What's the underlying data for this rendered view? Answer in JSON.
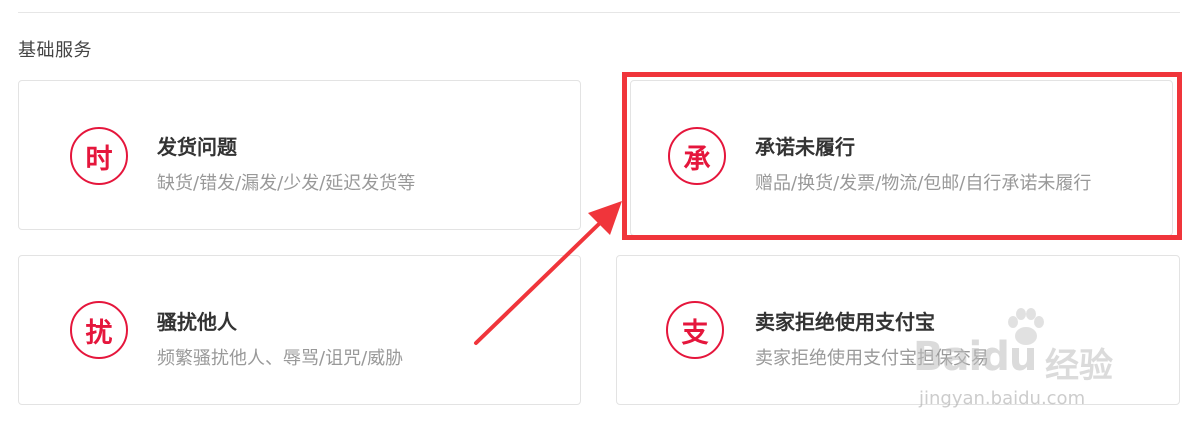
{
  "section_title": "基础服务",
  "cards": [
    {
      "badge": "时",
      "title": "发货问题",
      "desc": "缺货/错发/漏发/少发/延迟发货等"
    },
    {
      "badge": "承",
      "title": "承诺未履行",
      "desc": "赠品/换货/发票/物流/包邮/自行承诺未履行"
    },
    {
      "badge": "扰",
      "title": "骚扰他人",
      "desc": "频繁骚扰他人、辱骂/诅咒/威胁"
    },
    {
      "badge": "支",
      "title": "卖家拒绝使用支付宝",
      "desc": "卖家拒绝使用支付宝担保交易"
    }
  ],
  "watermark": {
    "logo": "Baidu",
    "cn": "经验",
    "url": "jingyan.baidu.com"
  },
  "colors": {
    "accent": "#e5163c",
    "highlight": "#f0353b"
  },
  "icons": [
    "arrow-icon",
    "paw-icon"
  ]
}
